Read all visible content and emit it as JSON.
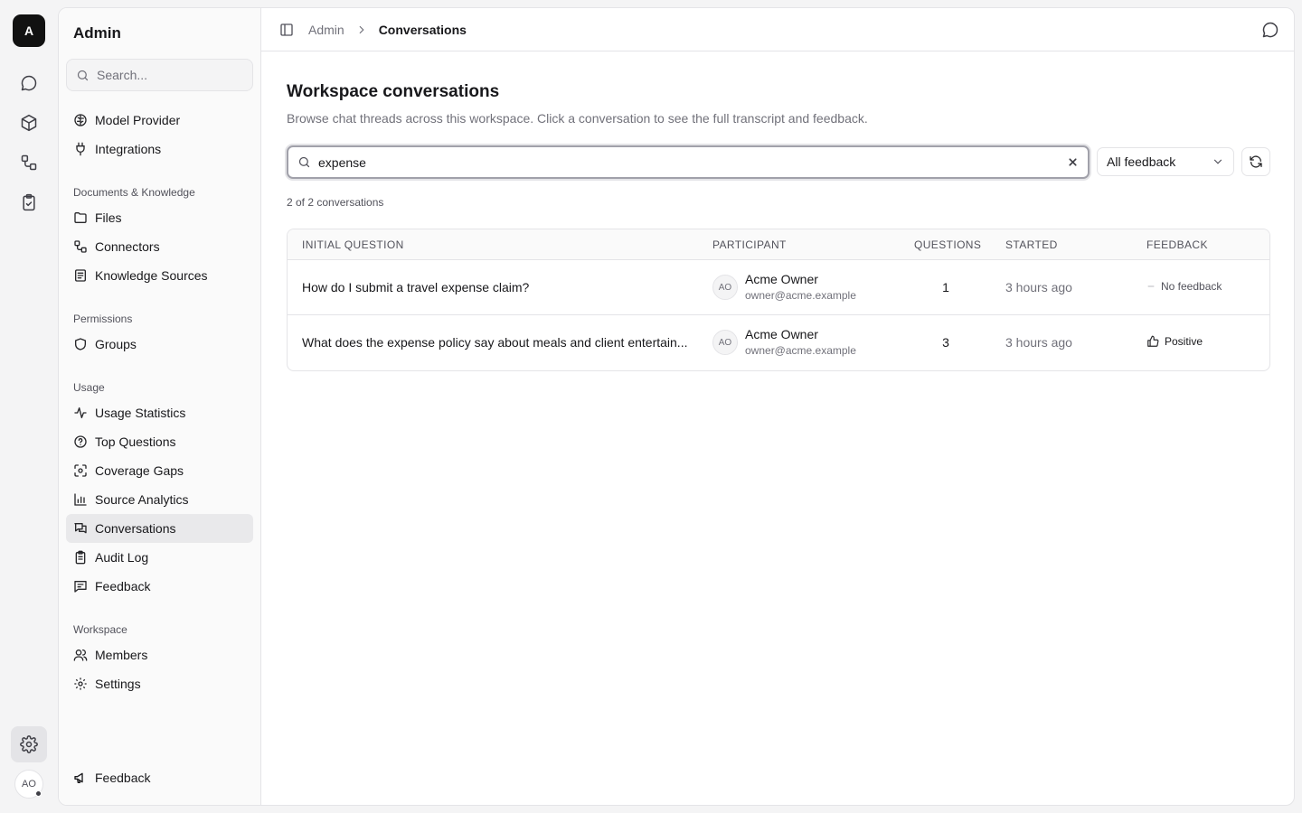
{
  "rail": {
    "logo": "A",
    "avatar": "AO"
  },
  "sidebar": {
    "title": "Admin",
    "search_placeholder": "Search...",
    "top_items": [
      {
        "label": "Model Provider",
        "icon": "brain-icon"
      },
      {
        "label": "Integrations",
        "icon": "plug-icon"
      }
    ],
    "groups": [
      {
        "label": "Documents & Knowledge",
        "items": [
          {
            "label": "Files",
            "icon": "folder-icon"
          },
          {
            "label": "Connectors",
            "icon": "connector-icon"
          },
          {
            "label": "Knowledge Sources",
            "icon": "book-icon"
          }
        ]
      },
      {
        "label": "Permissions",
        "items": [
          {
            "label": "Groups",
            "icon": "shield-icon"
          }
        ]
      },
      {
        "label": "Usage",
        "items": [
          {
            "label": "Usage Statistics",
            "icon": "activity-icon"
          },
          {
            "label": "Top Questions",
            "icon": "question-circle-icon"
          },
          {
            "label": "Coverage Gaps",
            "icon": "scan-icon"
          },
          {
            "label": "Source Analytics",
            "icon": "bar-chart-icon"
          },
          {
            "label": "Conversations",
            "icon": "chat-bubbles-icon",
            "active": true
          },
          {
            "label": "Audit Log",
            "icon": "clipboard-icon"
          },
          {
            "label": "Feedback",
            "icon": "message-square-icon"
          }
        ]
      },
      {
        "label": "Workspace",
        "items": [
          {
            "label": "Members",
            "icon": "users-icon"
          },
          {
            "label": "Settings",
            "icon": "gear-icon"
          }
        ]
      }
    ],
    "bottom_item": "Feedback"
  },
  "header": {
    "breadcrumb_root": "Admin",
    "breadcrumb_current": "Conversations"
  },
  "page": {
    "title": "Workspace conversations",
    "description": "Browse chat threads across this workspace. Click a conversation to see the full transcript and feedback.",
    "search_value": "expense",
    "filter_select": "All feedback",
    "count_text": "2 of 2 conversations"
  },
  "table": {
    "columns": [
      "INITIAL QUESTION",
      "PARTICIPANT",
      "QUESTIONS",
      "STARTED",
      "FEEDBACK"
    ],
    "rows": [
      {
        "question": "How do I submit a travel expense claim?",
        "avatar": "AO",
        "name": "Acme Owner",
        "email": "owner@acme.example",
        "questions": "1",
        "started": "3 hours ago",
        "feedback": "No feedback",
        "feedback_icon": "dash-icon"
      },
      {
        "question": "What does the expense policy say about meals and client entertain...",
        "avatar": "AO",
        "name": "Acme Owner",
        "email": "owner@acme.example",
        "questions": "3",
        "started": "3 hours ago",
        "feedback": "Positive",
        "feedback_icon": "thumbs-up-icon"
      }
    ]
  }
}
